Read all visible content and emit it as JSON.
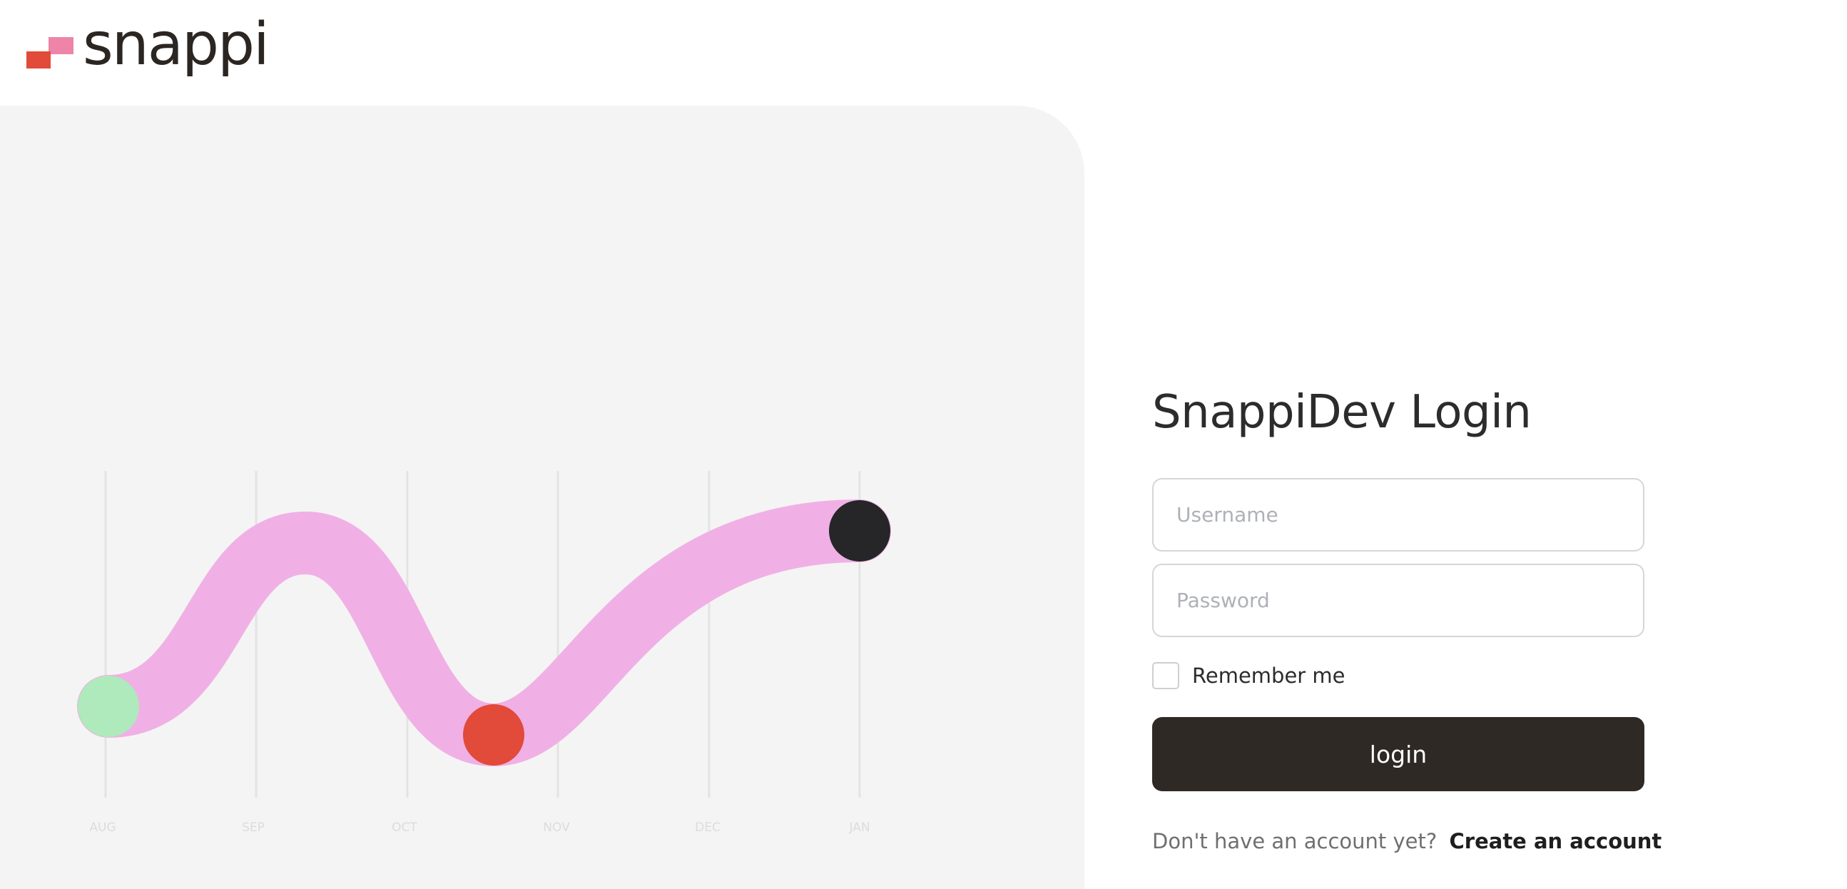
{
  "brand": {
    "name": "snappi",
    "colors": {
      "pink": "#ee84a8",
      "red": "#e24a39",
      "dark": "#2b2622"
    }
  },
  "illustration": {
    "months": [
      "AUG",
      "SEP",
      "OCT",
      "NOV",
      "DEC",
      "JAN"
    ],
    "colors": {
      "curve": "#f0b0e5",
      "start_dot": "#aeeabb",
      "mid_dot": "#e24a39",
      "end_dot": "#262528",
      "gridline": "#e3e3e3"
    }
  },
  "login": {
    "title": "SnappiDev Login",
    "username_placeholder": "Username",
    "password_placeholder": "Password",
    "remember_label": "Remember me",
    "remember_checked": false,
    "button_label": "login",
    "signup_prompt": "Don't have an account yet?",
    "signup_link": "Create an account",
    "button_color": "#2f2926"
  }
}
